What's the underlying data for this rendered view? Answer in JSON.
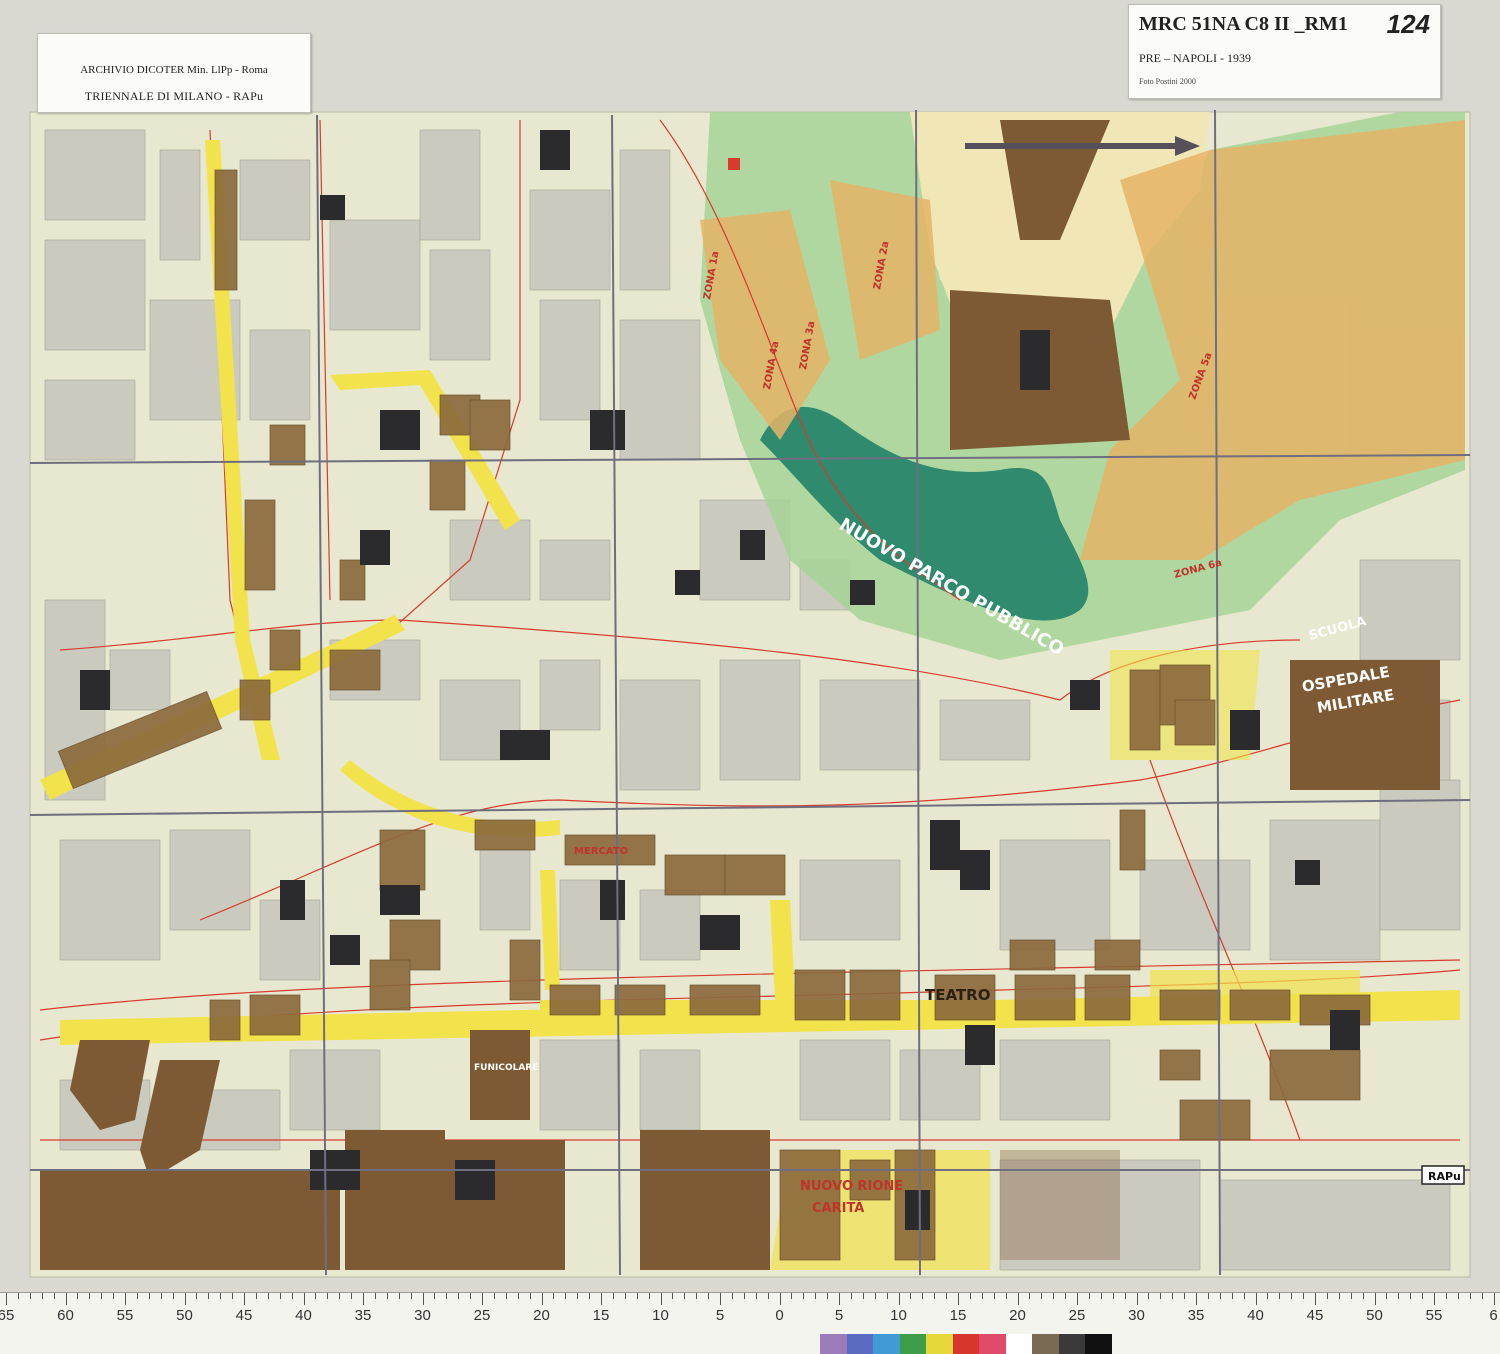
{
  "cards": {
    "left": {
      "line1": "ARCHIVIO DICOTER Min. LlPp - Roma",
      "line2": "TRIENNALE DI MILANO - RAPu"
    },
    "right": {
      "code": "MRC 51NA C8 II _RM1",
      "number": "124",
      "subtitle": "PRE – NAPOLI - 1939",
      "credit": "Foto Postini 2000"
    }
  },
  "map": {
    "labels": {
      "park": "NUOVO PARCO PUBBLICO",
      "ospedale_1": "OSPEDALE",
      "ospedale_2": "MILITARE",
      "scuola": "SCUOLA",
      "teatro": "TEATRO",
      "funicolare": "FUNICOLARE",
      "rione_1": "NUOVO RIONE",
      "rione_2": "CARITÀ",
      "mercato": "MERCATO",
      "stamp": "RAPu",
      "zone_a": "ZONA 1a",
      "zone_b": "ZONA 2a",
      "zone_c": "ZONA 3a",
      "zone_d": "ZONA 4a",
      "zone_e": "ZONA 5a",
      "zone_f": "ZONA 6a"
    },
    "colors": {
      "paper": "#e9ead0",
      "street": "#f3f1e2",
      "block_grey": "#c9c8bd",
      "redevelopment_brown": "#8c6a3c",
      "monument_brown": "#7d5a34",
      "church_black": "#2b2b2e",
      "widened_street_yellow": "#f2e24b",
      "park_green": "#2f8a6e",
      "light_green": "#9fcf8f",
      "zone_orange": "#e5b466",
      "street_red_line": "#d83a2e",
      "sheet_seam": "#6e6e80"
    }
  },
  "ruler": {
    "ticks": [
      "65",
      "60",
      "55",
      "50",
      "45",
      "40",
      "35",
      "30",
      "25",
      "20",
      "15",
      "10",
      "5",
      "0",
      "5",
      "10",
      "15",
      "20",
      "25",
      "30",
      "35",
      "40",
      "45",
      "50",
      "55",
      "6"
    ],
    "swatches": [
      "#9b7bb8",
      "#5b6bc4",
      "#3f9ad6",
      "#3c9d4a",
      "#e6d83b",
      "#d7362e",
      "#e04a6b",
      "#ffffff",
      "#7a6a54",
      "#3a3a3a",
      "#111111"
    ]
  }
}
